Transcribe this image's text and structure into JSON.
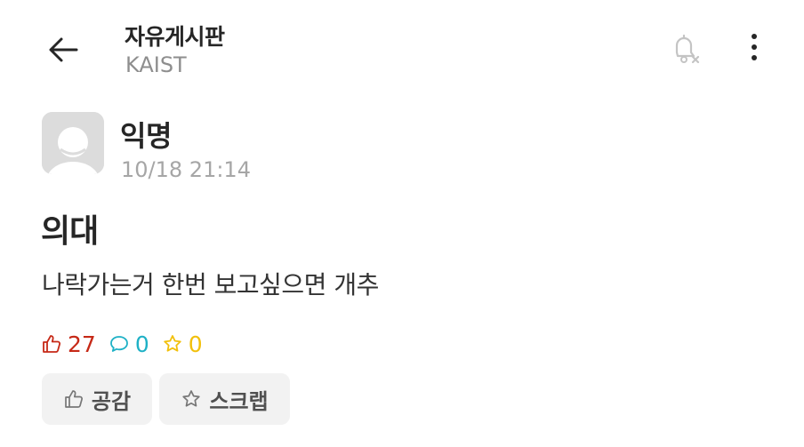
{
  "header": {
    "board_name": "자유게시판",
    "school": "KAIST",
    "back_icon": "arrow-left-icon",
    "notify_icon": "bell-off-icon",
    "more_icon": "more-vertical-icon"
  },
  "post": {
    "author": "익명",
    "time": "10/18 21:14",
    "title": "의대",
    "body": "나락가는거 한번 보고싶으면 개추",
    "stats": {
      "likes": "27",
      "comments": "0",
      "scraps": "0"
    }
  },
  "actions": {
    "like_label": "공감",
    "scrap_label": "스크랩"
  },
  "colors": {
    "like": "#c62917",
    "comment": "#1fb1c6",
    "scrap": "#f2c00b"
  }
}
